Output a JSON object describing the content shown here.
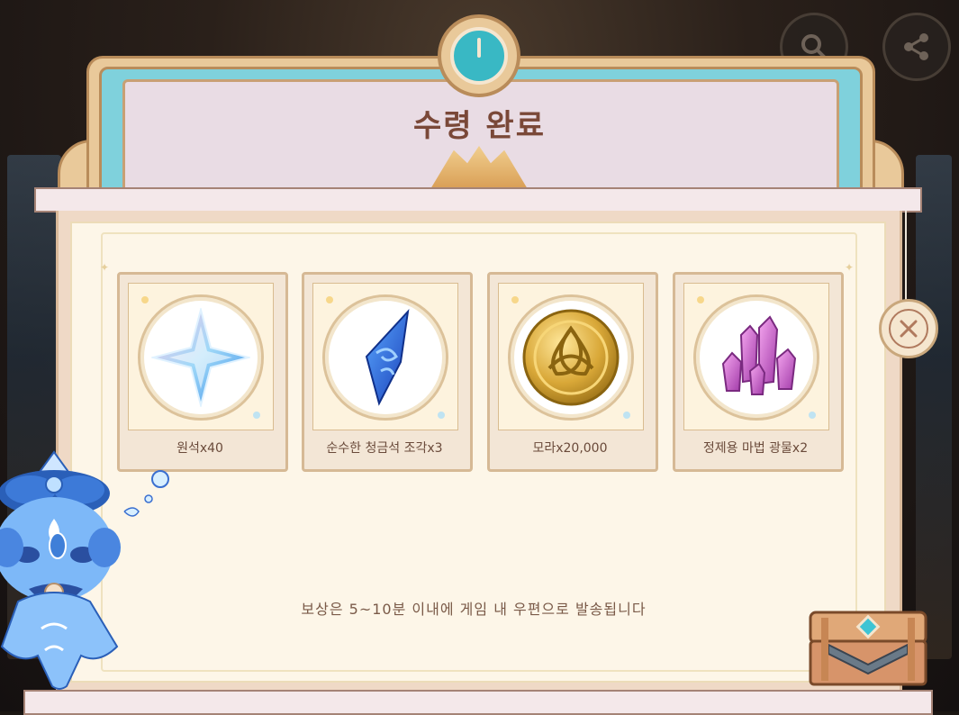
{
  "dialog": {
    "title": "수령 완료",
    "notice": "보상은 5~10분 이내에 게임 내 우편으로 발송됩니다"
  },
  "rewards": [
    {
      "icon": "primogem-icon",
      "label": "원석x40"
    },
    {
      "icon": "pure-azurite-fragment-icon",
      "label": "순수한 청금석 조각x3"
    },
    {
      "icon": "mora-coin-icon",
      "label": "모라x20,000"
    },
    {
      "icon": "mystic-enhancement-ore-icon",
      "label": "정제용 마법 광물x2"
    }
  ],
  "top_buttons": [
    "search-icon",
    "share-icon"
  ],
  "colors": {
    "title": "#7a4838",
    "panel": "#fdf6e8",
    "teal": "#7fd1dc",
    "gold": "#e9c99a"
  }
}
